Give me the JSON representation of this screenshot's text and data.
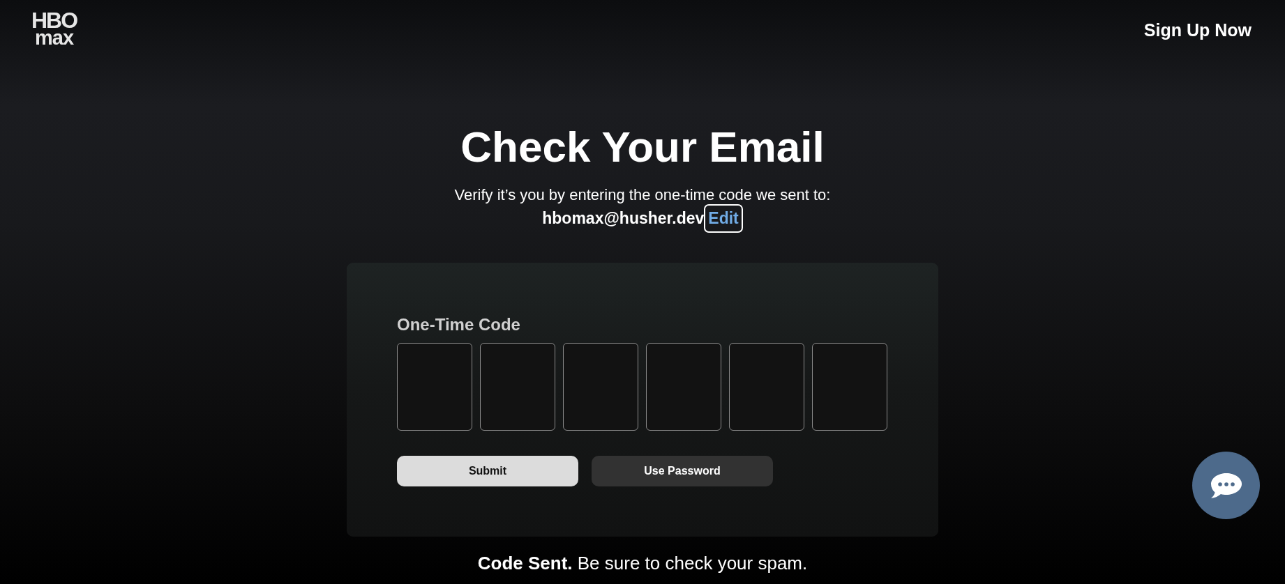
{
  "header": {
    "logo": {
      "line_1": "HBO",
      "line_2": "max"
    },
    "sign_up_link": "Sign Up Now"
  },
  "title": "Check Your Email",
  "subtitle": "Verify it’s you by entering the one-time code we sent to:",
  "email": {
    "address": "hbomax@husher.dev",
    "edit_link": "Edit",
    "edit_focused": true
  },
  "card": {
    "label": "One-Time Code",
    "code_boxes": [
      {
        "focused": false
      },
      {
        "focused": false
      },
      {
        "focused": false
      },
      {
        "focused": false
      },
      {
        "focused": false
      },
      {
        "focused": false
      }
    ],
    "buttons": [
      {
        "label": "Submit",
        "kind": "primary"
      },
      {
        "label": "Use Password",
        "kind": "secondary"
      }
    ]
  },
  "footer": "**Code Sent.** Be sure to check your spam."
}
